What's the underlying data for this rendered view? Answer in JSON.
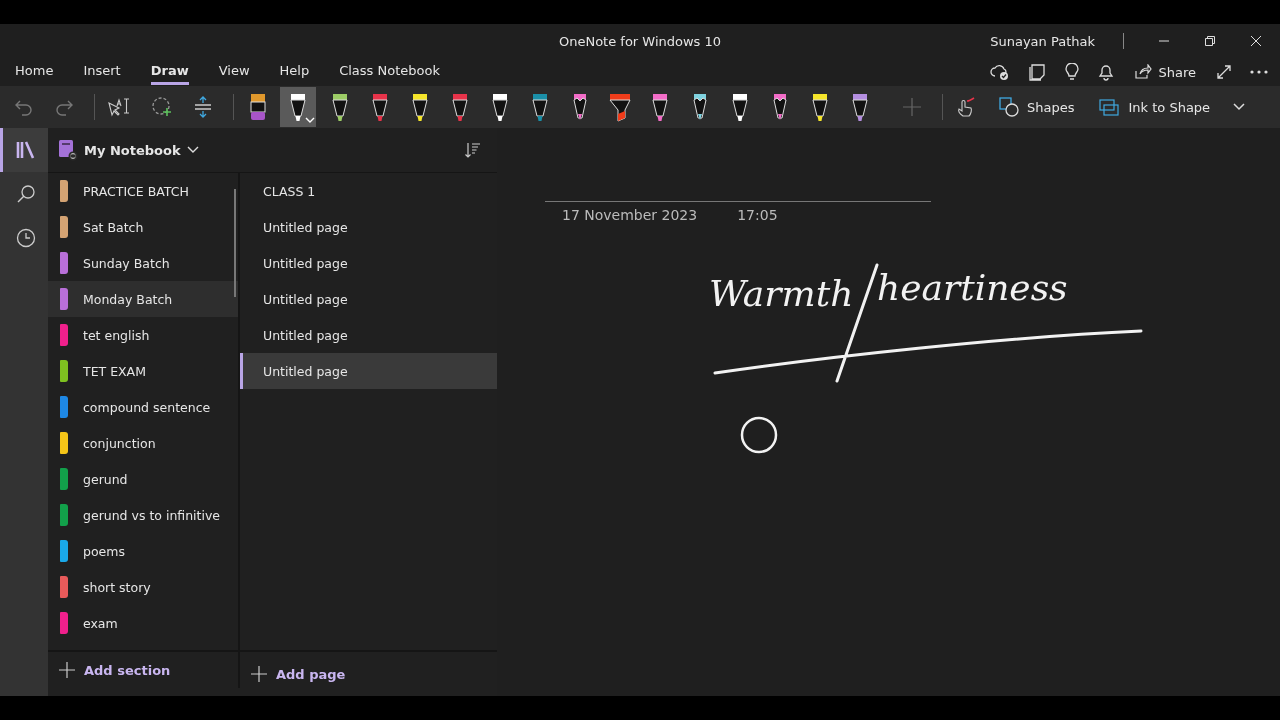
{
  "window": {
    "title": "OneNote for Windows 10",
    "user": "Sunayan Pathak"
  },
  "ribbon_tabs": [
    {
      "label": "Home",
      "selected": false
    },
    {
      "label": "Insert",
      "selected": false
    },
    {
      "label": "Draw",
      "selected": true
    },
    {
      "label": "View",
      "selected": false
    },
    {
      "label": "Help",
      "selected": false
    },
    {
      "label": "Class Notebook",
      "selected": false
    }
  ],
  "share": {
    "label": "Share"
  },
  "pens": [
    {
      "kind": "eraser",
      "color": "#a855c8",
      "selected": false
    },
    {
      "kind": "pen",
      "color": "#ffffff",
      "selected": true
    },
    {
      "kind": "pen",
      "color": "#9ccc65",
      "selected": false
    },
    {
      "kind": "pen",
      "color": "#e8334a",
      "selected": false
    },
    {
      "kind": "pen",
      "color": "#f5e52a",
      "selected": false
    },
    {
      "kind": "pen",
      "color": "#e8334a",
      "selected": false
    },
    {
      "kind": "pen",
      "color": "#ffffff",
      "selected": false
    },
    {
      "kind": "pen",
      "color": "#1a8fa8",
      "selected": false
    },
    {
      "kind": "pencil",
      "color": "#f36cc8",
      "selected": false
    },
    {
      "kind": "highlighter",
      "color": "#f03c1a",
      "selected": false
    },
    {
      "kind": "pen",
      "color": "#f36cc8",
      "selected": false
    },
    {
      "kind": "pencil",
      "color": "#7fd3e0",
      "selected": false
    },
    {
      "kind": "pen",
      "color": "#ffffff",
      "selected": false
    },
    {
      "kind": "pencil",
      "color": "#f36cc8",
      "selected": false
    },
    {
      "kind": "pen",
      "color": "#f5e52a",
      "selected": false
    },
    {
      "kind": "pen",
      "color": "#b48ee0",
      "selected": false
    }
  ],
  "toolbar_buttons": [
    {
      "label": "Shapes"
    },
    {
      "label": "Ink to Shape"
    }
  ],
  "notebook": {
    "name": "My Notebook"
  },
  "sections": [
    {
      "label": "PRACTICE BATCH",
      "color": "#d4a373",
      "selected": false
    },
    {
      "label": "Sat Batch",
      "color": "#d4a373",
      "selected": false
    },
    {
      "label": "Sunday Batch",
      "color": "#b86fd8",
      "selected": false
    },
    {
      "label": "Monday Batch",
      "color": "#b86fd8",
      "selected": true
    },
    {
      "label": "tet english",
      "color": "#f0208c",
      "selected": false
    },
    {
      "label": "TET EXAM",
      "color": "#7ec120",
      "selected": false
    },
    {
      "label": "compound sentence",
      "color": "#1e88e5",
      "selected": false
    },
    {
      "label": "conjunction",
      "color": "#f5c518",
      "selected": false
    },
    {
      "label": "gerund",
      "color": "#12a04a",
      "selected": false
    },
    {
      "label": "gerund vs to infinitive",
      "color": "#12a04a",
      "selected": false
    },
    {
      "label": "poems",
      "color": "#1aa8e8",
      "selected": false
    },
    {
      "label": "short story",
      "color": "#e85a5a",
      "selected": false
    },
    {
      "label": "exam",
      "color": "#f0208c",
      "selected": false
    }
  ],
  "pages": [
    {
      "label": "CLASS 1",
      "selected": false
    },
    {
      "label": "Untitled page",
      "selected": false
    },
    {
      "label": "Untitled page",
      "selected": false
    },
    {
      "label": "Untitled page",
      "selected": false
    },
    {
      "label": "Untitled page",
      "selected": false
    },
    {
      "label": "Untitled page",
      "selected": true
    }
  ],
  "add_section": "Add section",
  "add_page": "Add page",
  "page": {
    "date": "17 November 2023",
    "time": "17:05",
    "ink_words": [
      "Warmth",
      "heartiness"
    ]
  }
}
